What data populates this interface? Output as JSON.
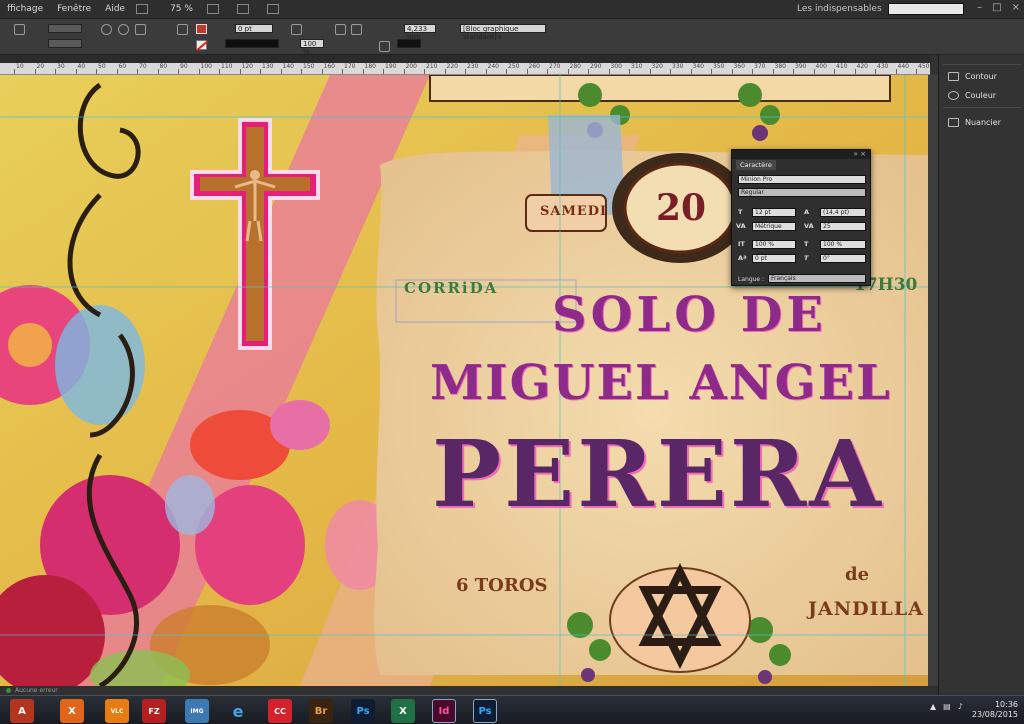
{
  "menubar": {
    "items": [
      "ffichage",
      "Fenêtre",
      "Aide"
    ],
    "zoom": "75 %",
    "workspace": "Les indispensables",
    "search_placeholder": ""
  },
  "control": {
    "stroke_weight": "0 pt",
    "scale_x": "100 %",
    "scale_y": "100 %",
    "dimension": "4,233 mm",
    "object_style": "[Bloc graphique standard]+"
  },
  "ruler": {
    "labels": [
      "10",
      "20",
      "30",
      "40",
      "50",
      "60",
      "70",
      "80",
      "90",
      "100",
      "110",
      "120",
      "130",
      "140",
      "150",
      "160",
      "170",
      "180",
      "190",
      "200",
      "210",
      "220",
      "230",
      "240",
      "250",
      "260",
      "270",
      "280",
      "290",
      "300",
      "310",
      "320",
      "330",
      "340",
      "350",
      "360",
      "370",
      "380",
      "390",
      "400",
      "410",
      "420",
      "430",
      "440",
      "450"
    ]
  },
  "poster": {
    "top_left": "SAMEDI",
    "day_number": "20",
    "corrida": "CORRiDA",
    "time": "17H30",
    "line1": "SOLO DE",
    "line2": "MIGUEL ANGEL",
    "name": "PERERA",
    "bulls": "6 TOROS",
    "de": "de",
    "ranch": "JANDILLA"
  },
  "charpanel": {
    "tab": "Caractère",
    "font_family": "Minion Pro",
    "font_style": "Regular",
    "size": "12 pt",
    "leading": "(14,4 pt)",
    "kerning": "Métrique",
    "tracking": "25",
    "vscale": "100 %",
    "hscale": "100 %",
    "baseline": "0 pt",
    "skew": "0°",
    "language_label": "Langue :",
    "language": "Français"
  },
  "rpanel": {
    "items": [
      "Contour",
      "Couleur",
      "Nuancier"
    ]
  },
  "status": {
    "text": "Aucune erreur"
  },
  "taskbar": {
    "apps": [
      "A",
      "X",
      "VLC",
      "FZ",
      "IMG",
      "e",
      "CC",
      "Br",
      "Ps",
      "X",
      "Id",
      "Ps"
    ],
    "time": "10:36",
    "date": "23/08/2015"
  },
  "colors": {
    "poster_magenta": "#d1289b",
    "poster_purple": "#5a2766",
    "poster_green": "#3f7a3c",
    "poster_brown": "#7a3b1c",
    "parchment": "#f1d6a6"
  }
}
